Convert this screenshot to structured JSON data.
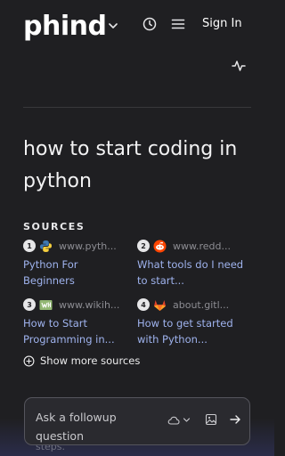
{
  "header": {
    "logo": "phind",
    "signin_label": "Sign In"
  },
  "icons": {
    "logo_chevron": "chevron-down-icon",
    "history": "clock-icon",
    "menu": "hamburger-menu-icon",
    "activity": "activity-pulse-icon",
    "show_more": "plus-circle-icon",
    "model": "cloud-icon",
    "image": "image-icon",
    "send": "arrow-right-icon"
  },
  "main": {
    "question": "how to start coding in python",
    "sources_label": "SOURCES",
    "sources": [
      {
        "num": "1",
        "domain": "www.pyth...",
        "title": "Python For Beginners",
        "favicon": "python-logo-icon"
      },
      {
        "num": "2",
        "domain": "www.redd...",
        "title": "What tools do I need to start...",
        "favicon": "reddit-logo-icon"
      },
      {
        "num": "3",
        "domain": "www.wikih...",
        "title": "How to Start Programming in...",
        "favicon": "wikihow-logo-icon"
      },
      {
        "num": "4",
        "domain": "about.gitl...",
        "title": "How to get started with Python...",
        "favicon": "gitlab-logo-icon"
      }
    ],
    "show_more_label": "Show more sources"
  },
  "followup": {
    "placeholder": "Ask a followup question",
    "behind_text": "steps."
  },
  "colors": {
    "background": "#1f1f22",
    "link": "#9fb3ee",
    "muted": "#8d8d93"
  }
}
